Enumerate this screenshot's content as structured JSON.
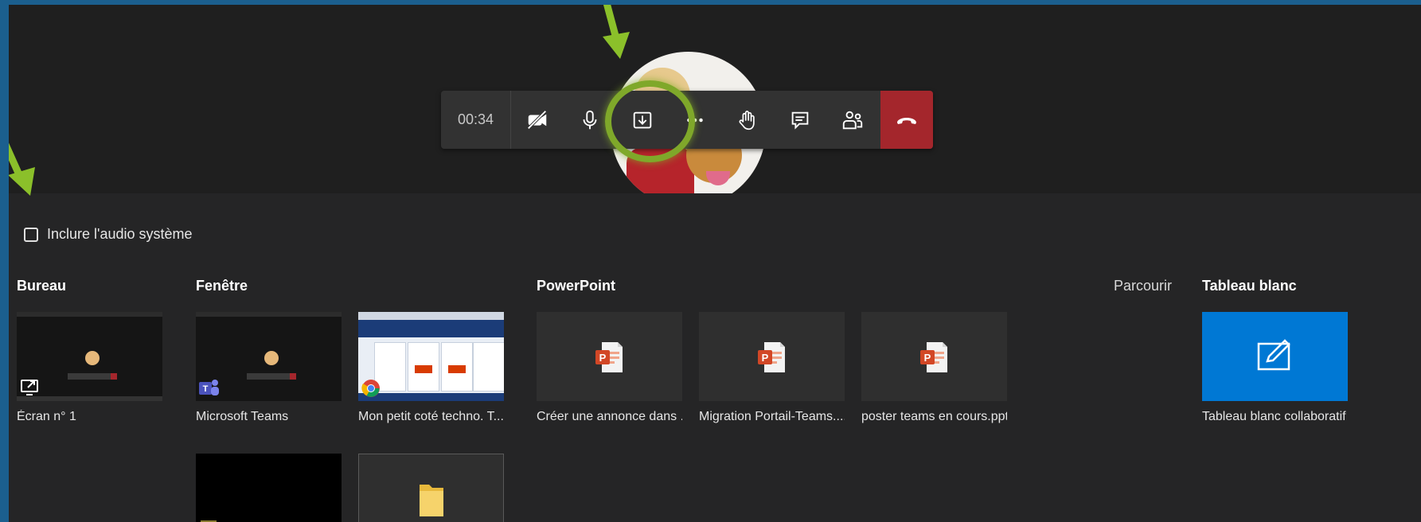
{
  "call": {
    "timer": "00:34"
  },
  "share": {
    "include_audio_label": "Inclure l'audio système",
    "sections": {
      "bureau": "Bureau",
      "fenetre": "Fenêtre",
      "powerpoint": "PowerPoint",
      "browse": "Parcourir",
      "whiteboard": "Tableau blanc"
    },
    "screens": [
      {
        "label": "Écran n° 1"
      }
    ],
    "windows": [
      {
        "label": "Microsoft Teams"
      },
      {
        "label": "Mon petit coté techno. T..."
      }
    ],
    "powerpoint_files": [
      {
        "label": "Créer une annonce dans ..."
      },
      {
        "label": "Migration Portail-Teams...."
      },
      {
        "label": "poster teams en cours.pptx"
      }
    ],
    "whiteboard": {
      "label": "Tableau blanc collaboratif M"
    }
  },
  "colors": {
    "accent_highlight": "#7fa82a",
    "hangup": "#a4262c",
    "whiteboard": "#0078d4",
    "powerpoint": "#d24726"
  }
}
